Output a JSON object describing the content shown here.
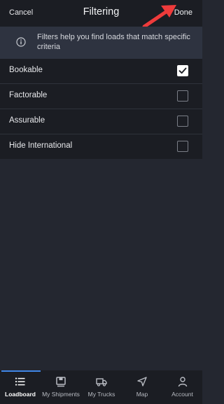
{
  "header": {
    "cancel_label": "Cancel",
    "title": "Filtering",
    "done_label": "Done"
  },
  "info": {
    "icon": "info-icon",
    "text": "Filters help you find loads that match specific criteria"
  },
  "filters": [
    {
      "label": "Bookable",
      "checked": true
    },
    {
      "label": "Factorable",
      "checked": false
    },
    {
      "label": "Assurable",
      "checked": false
    },
    {
      "label": "Hide International",
      "checked": false
    }
  ],
  "tabbar": {
    "active": "Loadboard",
    "items": [
      {
        "label": "Loadboard",
        "icon": "list-icon"
      },
      {
        "label": "My Shipments",
        "icon": "shipment-icon"
      },
      {
        "label": "My Trucks",
        "icon": "truck-icon"
      },
      {
        "label": "Map",
        "icon": "navigation-icon"
      },
      {
        "label": "Account",
        "icon": "person-icon"
      }
    ]
  },
  "colors": {
    "background": "#242730",
    "header": "#1b1d23",
    "info_banner": "#2e3340",
    "accent": "#3f86e6",
    "annotation_arrow": "#ee3b3b"
  }
}
